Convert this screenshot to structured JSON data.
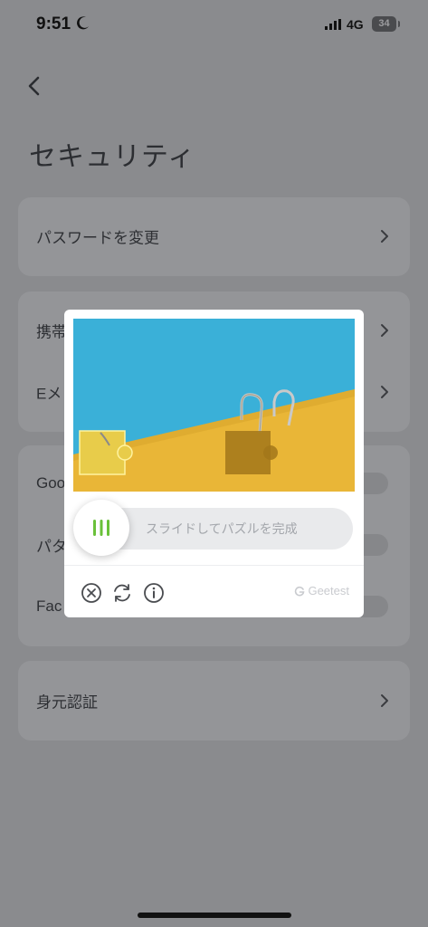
{
  "status_bar": {
    "time": "9:51",
    "network": "4G",
    "battery": "34"
  },
  "header": {
    "title": "セキュリティ"
  },
  "cards": {
    "password": {
      "label": "パスワードを変更"
    },
    "contact": {
      "phone_label": "携帯",
      "email_label": "Eメ"
    },
    "auth": {
      "google_label": "Goo",
      "pattern_label": "パタ",
      "face_label": "Fac"
    },
    "identity": {
      "label": "身元認証"
    }
  },
  "captcha": {
    "slider_hint": "スライドしてパズルを完成",
    "brand": "Geetest",
    "colors": {
      "sky": "#3ab0d8",
      "sand": "#e9b637",
      "knob_grip": "#6ac13a"
    }
  },
  "icons": {
    "back": "chevron-left-icon",
    "row": "chevron-right-icon",
    "close": "close-circle-icon",
    "refresh": "refresh-icon",
    "info": "info-icon"
  }
}
